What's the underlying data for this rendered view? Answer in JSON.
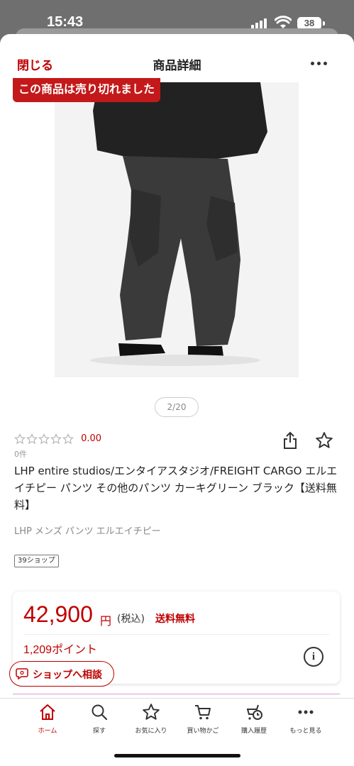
{
  "status_bar": {
    "time": "15:43",
    "battery": "38"
  },
  "header": {
    "close_label": "閉じる",
    "title": "商品詳細"
  },
  "product": {
    "sold_out_label": "この商品は売り切れました",
    "image_counter": "2/20",
    "rating_value": "0.00",
    "review_count": "0件",
    "title": "LHP entire studios/エンタイアスタジオ/FREIGHT CARGO エルエイチピー パンツ その他のパンツ カーキグリーン ブラック【送料無料】",
    "breadcrumb": "LHP メンズ パンツ エルエイチピー",
    "shop_badge": "39ショップ"
  },
  "price": {
    "amount": "42,900",
    "yen": "円",
    "tax": "(税込)",
    "shipping": "送料無料",
    "points": "1,209ポイント"
  },
  "chat_button": {
    "label": "ショップへ相談"
  },
  "tab_bar": {
    "items": [
      {
        "label": "ホーム",
        "icon": "home-icon"
      },
      {
        "label": "探す",
        "icon": "search-icon"
      },
      {
        "label": "お気に入り",
        "icon": "star-icon"
      },
      {
        "label": "買い物かご",
        "icon": "cart-icon"
      },
      {
        "label": "購入履歴",
        "icon": "history-icon"
      },
      {
        "label": "もっと見る",
        "icon": "more-icon"
      }
    ]
  },
  "colors": {
    "accent": "#bf0000",
    "sold_out": "#c4191a"
  }
}
